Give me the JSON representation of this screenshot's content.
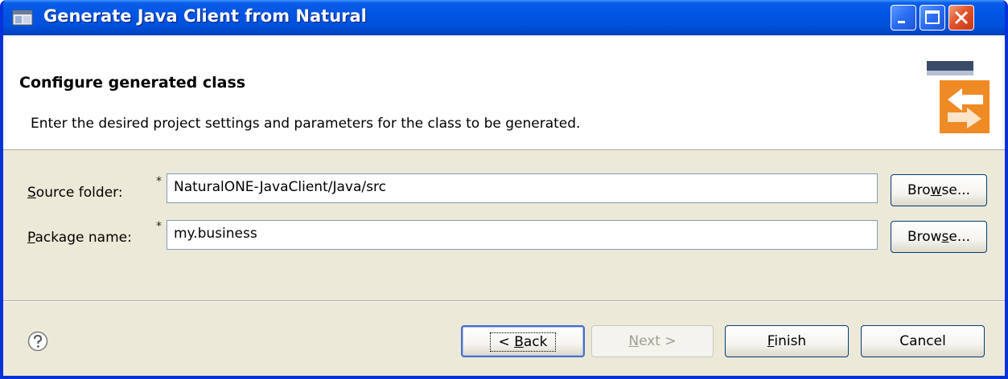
{
  "window": {
    "title": "Generate Java Client from Natural"
  },
  "banner": {
    "title": "Configure generated class",
    "description": "Enter the desired project settings and parameters for the class to be generated."
  },
  "form": {
    "source_folder": {
      "label_pre": "",
      "label_mnemonic": "S",
      "label_post": "ource folder:",
      "required_marker": "*",
      "value": "NaturalONE-JavaClient/Java/src",
      "browse_pre": "Bro",
      "browse_mnemonic": "w",
      "browse_post": "se..."
    },
    "package_name": {
      "label_pre": "",
      "label_mnemonic": "P",
      "label_post": "ackage name:",
      "required_marker": "*",
      "value": "my.business",
      "browse_pre": "Brow",
      "browse_mnemonic": "s",
      "browse_post": "e..."
    }
  },
  "footer": {
    "back_pre": "< ",
    "back_mnemonic": "B",
    "back_post": "ack",
    "next_pre": "",
    "next_mnemonic": "N",
    "next_post": "ext >",
    "finish_pre": "",
    "finish_mnemonic": "F",
    "finish_post": "inish",
    "cancel_label": "Cancel"
  },
  "colors": {
    "titlebar": "#0054e3",
    "window_face": "#ece9d8",
    "accent_orange": "#f08a24"
  },
  "icons": {
    "title": "eclipse-window-icon",
    "help": "help-question-icon",
    "wizard": "java-client-wizard-icon"
  }
}
